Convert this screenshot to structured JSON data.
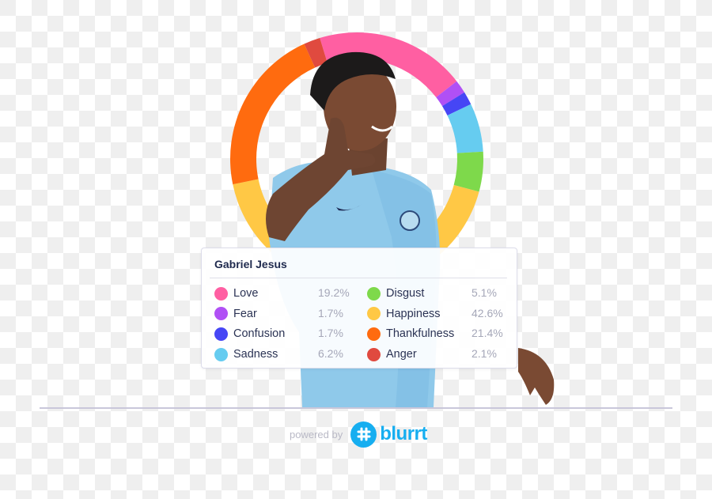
{
  "card": {
    "title": "Gabriel Jesus"
  },
  "emotions": [
    {
      "label": "Love",
      "percent": "19.2%",
      "value": 19.2,
      "color": "#FF5FA2"
    },
    {
      "label": "Fear",
      "percent": "1.7%",
      "value": 1.7,
      "color": "#B050F5"
    },
    {
      "label": "Confusion",
      "percent": "1.7%",
      "value": 1.7,
      "color": "#4646F5"
    },
    {
      "label": "Sadness",
      "percent": "6.2%",
      "value": 6.2,
      "color": "#66CCF0"
    },
    {
      "label": "Disgust",
      "percent": "5.1%",
      "value": 5.1,
      "color": "#7ED94B"
    },
    {
      "label": "Happiness",
      "percent": "42.6%",
      "value": 42.6,
      "color": "#FFC845"
    },
    {
      "label": "Thankfulness",
      "percent": "21.4%",
      "value": 21.4,
      "color": "#FF6B0F"
    },
    {
      "label": "Anger",
      "percent": "2.1%",
      "value": 2.1,
      "color": "#E04A3F"
    }
  ],
  "footer": {
    "powered_by": "powered by",
    "brand": "blurrt",
    "brand_color": "#16AEF0"
  },
  "subject_image": "smiling footballer in light blue Manchester City jersey making a phone gesture"
}
